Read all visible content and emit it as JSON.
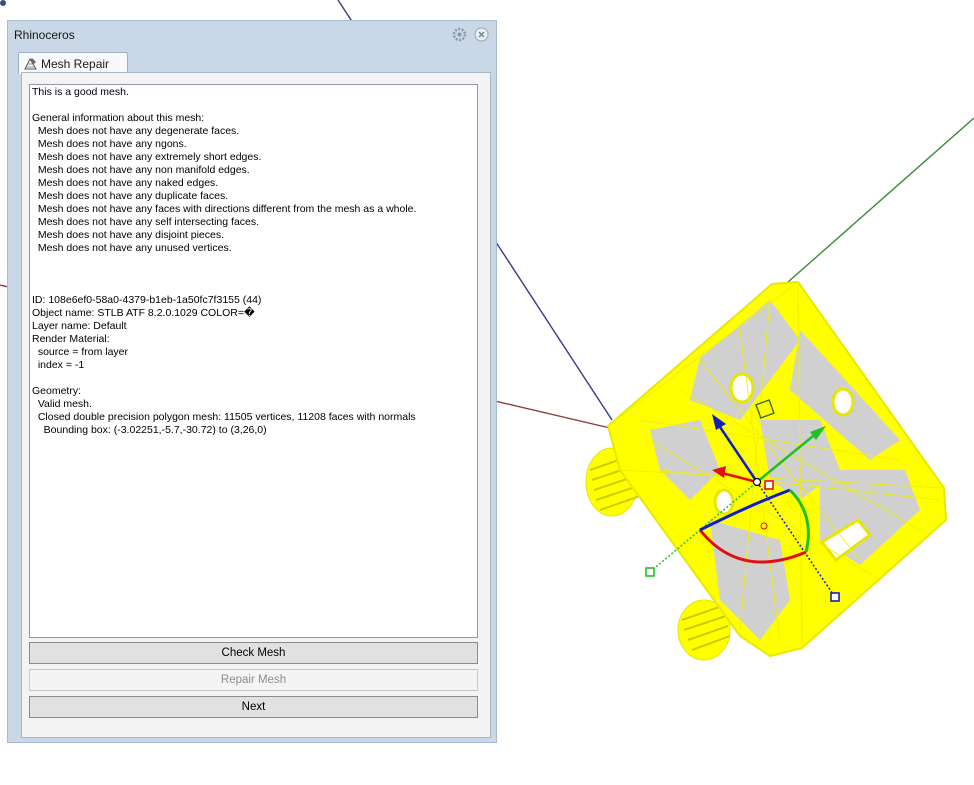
{
  "window": {
    "title": "Rhinoceros"
  },
  "tab": {
    "label": "Mesh Repair",
    "icon": "mesh-repair-icon"
  },
  "report": {
    "lines": [
      "This is a good mesh.",
      "",
      "General information about this mesh:",
      "  Mesh does not have any degenerate faces.",
      "  Mesh does not have any ngons.",
      "  Mesh does not have any extremely short edges.",
      "  Mesh does not have any non manifold edges.",
      "  Mesh does not have any naked edges.",
      "  Mesh does not have any duplicate faces.",
      "  Mesh does not have any faces with directions different from the mesh as a whole.",
      "  Mesh does not have any self intersecting faces.",
      "  Mesh does not have any disjoint pieces.",
      "  Mesh does not have any unused vertices.",
      "",
      "",
      "",
      "ID: 108e6ef0-58a0-4379-b1eb-1a50fc7f3155 (44)",
      "Object name: STLB ATF 8.2.0.1029 COLOR=\u0000",
      "Layer name: Default",
      "Render Material:",
      "  source = from layer",
      "  index = -1",
      "",
      "Geometry:",
      "  Valid mesh.",
      "  Closed double precision polygon mesh: 11505 vertices, 11208 faces with normals",
      "    Bounding box: (-3.02251,-5.7,-30.72) to (3,26,0)"
    ]
  },
  "buttons": {
    "check_mesh": "Check Mesh",
    "repair_mesh": "Repair Mesh",
    "next": "Next"
  },
  "colors": {
    "mesh_wire": "#ffff00",
    "mesh_face": "#d0d0d0",
    "axis_x": "#8b3a3a",
    "axis_y": "#3a8a3a",
    "axis_z": "#3a3a8a",
    "gumball_red": "#e01010",
    "gumball_green": "#20c020",
    "gumball_blue": "#1020c0"
  }
}
